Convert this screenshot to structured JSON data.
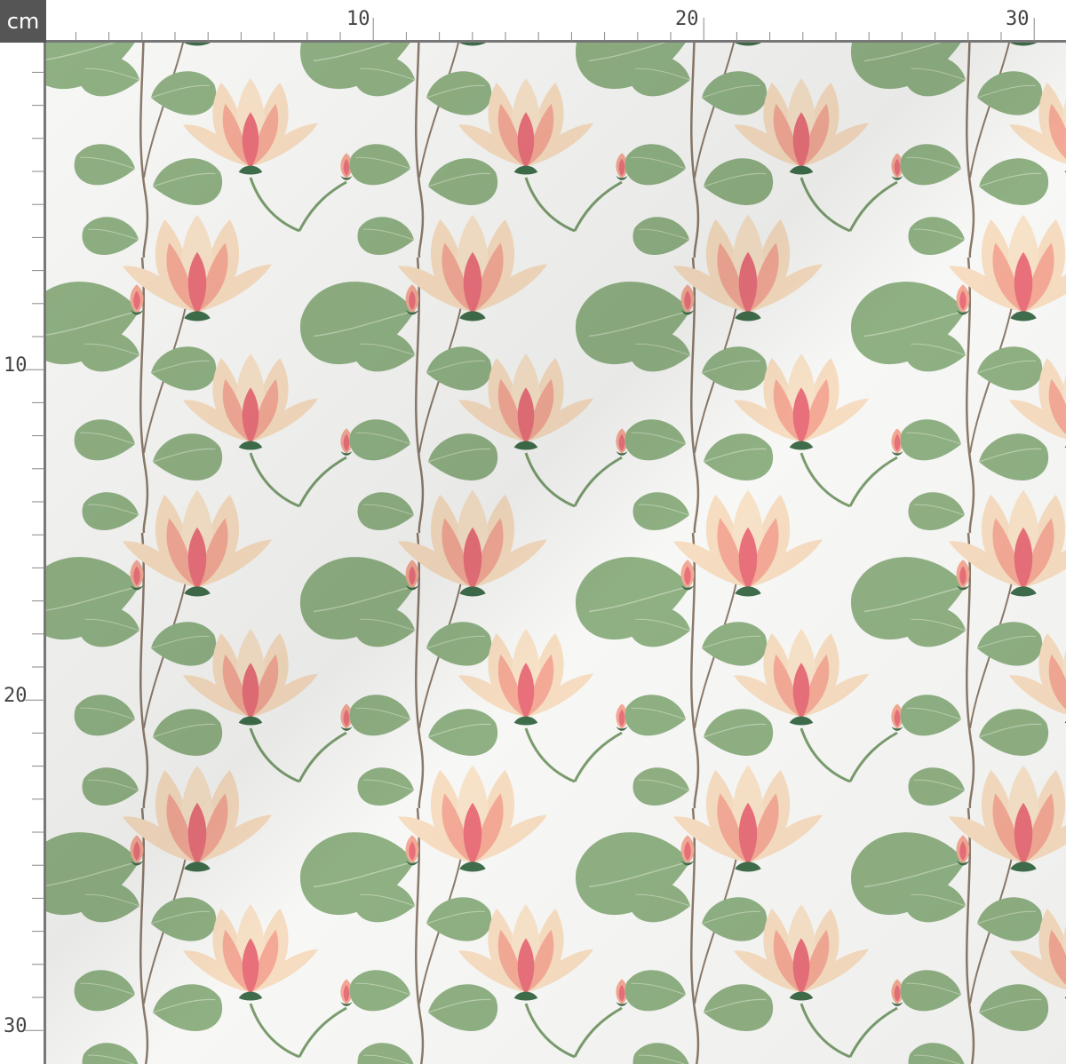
{
  "ruler": {
    "unit": "cm",
    "top_labels": [
      "10",
      "20",
      "30"
    ],
    "left_labels": [
      "10",
      "20",
      "30"
    ]
  },
  "colors": {
    "fabric": "#f7f7f5",
    "ruler_bg": "#ffffff",
    "ruler_edge": "#777777",
    "corner_bg": "#555555",
    "leaf": "#8fb083",
    "leaf_dark": "#7a9c6e",
    "stem": "#8b7a6a",
    "petal_light": "#f6dcc0",
    "petal_mid": "#f3a995",
    "petal_dark": "#e8707a",
    "calyx": "#3f6d4b"
  }
}
